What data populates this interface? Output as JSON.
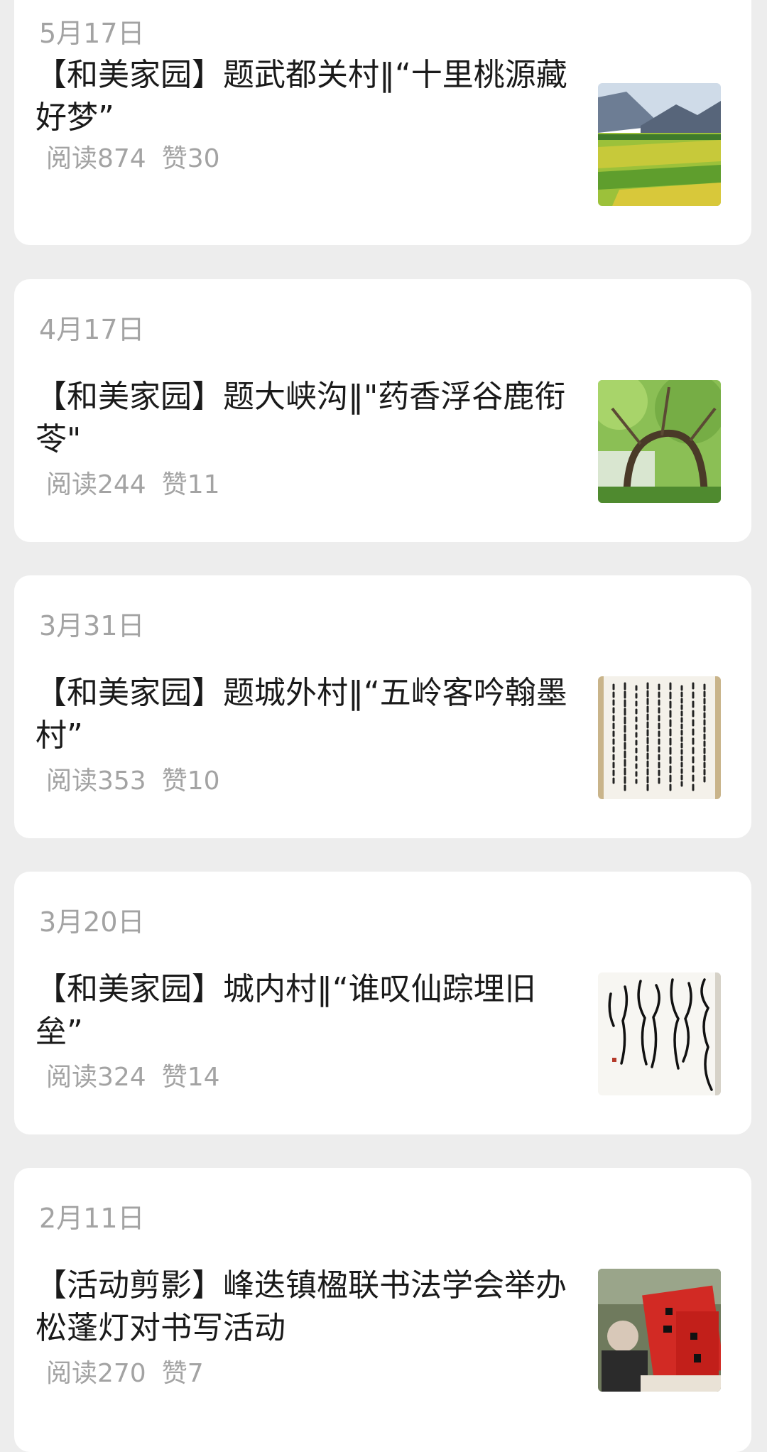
{
  "feed": {
    "articles": [
      {
        "date": "5月17日",
        "title": "【和美家园】题武都关村‖“十里桃源藏好梦”",
        "reads": "阅读874",
        "likes": "赞30",
        "thumbnail": "valley-fields-photo"
      },
      {
        "date": "4月17日",
        "title": "【和美家园】题大峡沟‖\"药香浮谷鹿衔苓\"",
        "reads": "阅读244",
        "likes": "赞11",
        "thumbnail": "arched-tree-photo"
      },
      {
        "date": "3月31日",
        "title": "【和美家园】题城外村‖“五岭客吟翰墨村”",
        "reads": "阅读353",
        "likes": "赞10",
        "thumbnail": "calligraphy-scroll-photo"
      },
      {
        "date": "3月20日",
        "title": "【和美家园】城内村‖“谁叹仙踪埋旧垒”",
        "reads": "阅读324",
        "likes": "赞14",
        "thumbnail": "calligraphy-cursive-photo"
      },
      {
        "date": "2月11日",
        "title": "【活动剪影】峰迭镇楹联书法学会举办松蓬灯对书写活动",
        "reads": "阅读270",
        "likes": "赞7",
        "thumbnail": "couplet-writing-event-photo"
      }
    ]
  }
}
